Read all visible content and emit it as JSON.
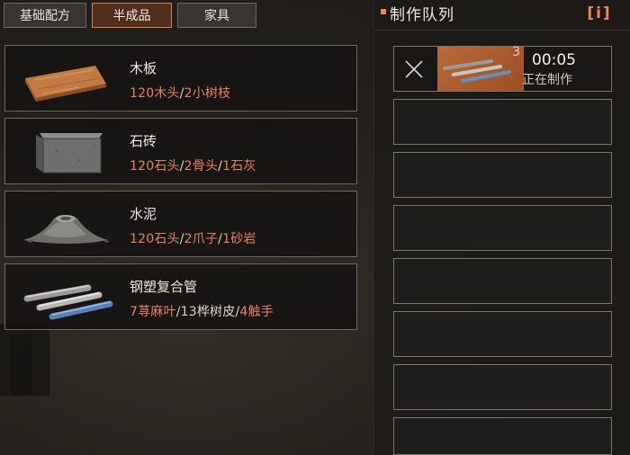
{
  "tabs": [
    {
      "label": "基础配方",
      "active": false
    },
    {
      "label": "半成品",
      "active": true
    },
    {
      "label": "家具",
      "active": false
    }
  ],
  "recipes": [
    {
      "name": "木板",
      "icon": "wood-plank-icon",
      "requirements": [
        {
          "text": "120木头"
        },
        {
          "text": "/",
          "sep": true
        },
        {
          "text": "2小树枝"
        }
      ]
    },
    {
      "name": "石砖",
      "icon": "stone-brick-icon",
      "requirements": [
        {
          "text": "120石头"
        },
        {
          "text": "/",
          "sep": true
        },
        {
          "text": "2骨头"
        },
        {
          "text": "/",
          "sep": true
        },
        {
          "text": "1石灰"
        }
      ]
    },
    {
      "name": "水泥",
      "icon": "cement-pile-icon",
      "requirements": [
        {
          "text": "120石头"
        },
        {
          "text": "/",
          "sep": true
        },
        {
          "text": "2爪子"
        },
        {
          "text": "/",
          "sep": true
        },
        {
          "text": "1砂岩"
        }
      ]
    },
    {
      "name": "钢塑复合管",
      "icon": "steel-plastic-pipe-icon",
      "requirements": [
        {
          "text": "7荨麻叶"
        },
        {
          "text": "/",
          "sep": true
        },
        {
          "text": "13桦树皮"
        },
        {
          "text": "/",
          "sep": true
        },
        {
          "text": "4触手"
        }
      ]
    }
  ],
  "queue": {
    "title": "制作队列",
    "info_label": "[i]",
    "active": {
      "icon": "steel-plastic-pipe-icon",
      "count": "3",
      "timer": "00:05",
      "status": "正在制作"
    },
    "empty_slots": 7
  },
  "colors": {
    "accent": "#e07a45",
    "requirement": "#e8805e"
  }
}
